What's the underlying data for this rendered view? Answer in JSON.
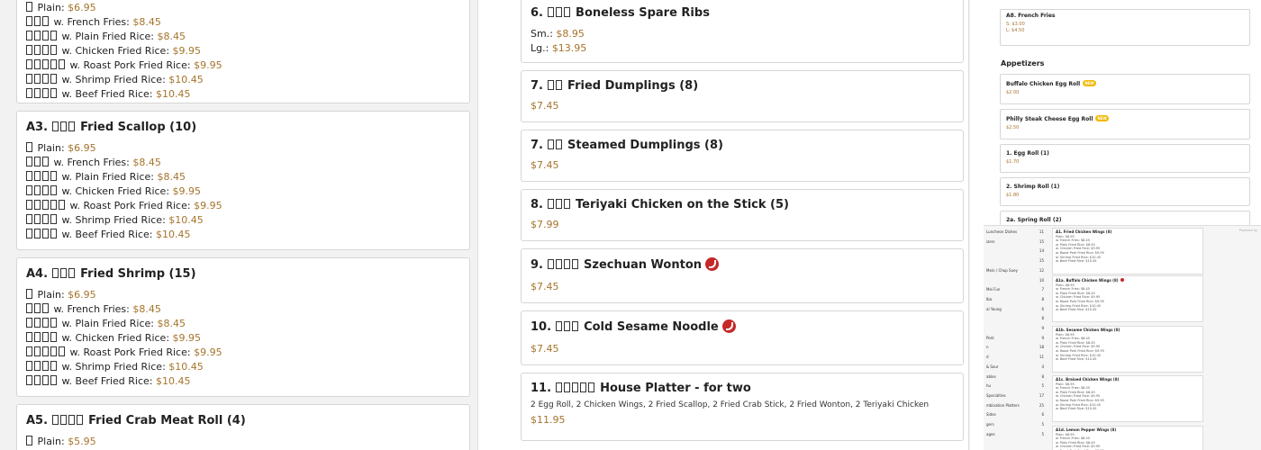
{
  "left": {
    "top_partial": {
      "lines": [
        {
          "sq": 1,
          "label": "Plain:",
          "price": "$6.95"
        },
        {
          "sq": 3,
          "label": "w. French Fries:",
          "price": "$8.45"
        },
        {
          "sq": 4,
          "label": "w. Plain Fried Rice:",
          "price": "$8.45"
        },
        {
          "sq": 4,
          "label": "w. Chicken Fried Rice:",
          "price": "$9.95"
        },
        {
          "sq": 5,
          "label": "w. Roast Pork Fried Rice:",
          "price": "$9.95"
        },
        {
          "sq": 4,
          "label": "w. Shrimp Fried Rice:",
          "price": "$10.45"
        },
        {
          "sq": 4,
          "label": "w. Beef Fried Rice:",
          "price": "$10.45"
        }
      ]
    },
    "a3": {
      "prefix": "A3.",
      "cn_count": 3,
      "title": "Fried Scallop (10)",
      "lines": [
        {
          "sq": 1,
          "label": "Plain:",
          "price": "$6.95"
        },
        {
          "sq": 3,
          "label": "w. French Fries:",
          "price": "$8.45"
        },
        {
          "sq": 4,
          "label": "w. Plain Fried Rice:",
          "price": "$8.45"
        },
        {
          "sq": 4,
          "label": "w. Chicken Fried Rice:",
          "price": "$9.95"
        },
        {
          "sq": 5,
          "label": "w. Roast Pork Fried Rice:",
          "price": "$9.95"
        },
        {
          "sq": 4,
          "label": "w. Shrimp Fried Rice:",
          "price": "$10.45"
        },
        {
          "sq": 4,
          "label": "w. Beef Fried Rice:",
          "price": "$10.45"
        }
      ]
    },
    "a4": {
      "prefix": "A4.",
      "cn_count": 3,
      "title": "Fried Shrimp (15)",
      "lines": [
        {
          "sq": 1,
          "label": "Plain:",
          "price": "$6.95"
        },
        {
          "sq": 3,
          "label": "w. French Fries:",
          "price": "$8.45"
        },
        {
          "sq": 4,
          "label": "w. Plain Fried Rice:",
          "price": "$8.45"
        },
        {
          "sq": 4,
          "label": "w. Chicken Fried Rice:",
          "price": "$9.95"
        },
        {
          "sq": 5,
          "label": "w. Roast Pork Fried Rice:",
          "price": "$9.95"
        },
        {
          "sq": 4,
          "label": "w. Shrimp Fried Rice:",
          "price": "$10.45"
        },
        {
          "sq": 4,
          "label": "w. Beef Fried Rice:",
          "price": "$10.45"
        }
      ]
    },
    "a5": {
      "prefix": "A5.",
      "cn_count": 4,
      "title": "Fried Crab Meat Roll (4)",
      "lines": [
        {
          "sq": 1,
          "label": "Plain:",
          "price": "$5.95"
        }
      ]
    }
  },
  "middle": {
    "items": [
      {
        "num": "6.",
        "cn_count": 3,
        "title": "Boneless Spare Ribs",
        "spicy": false,
        "prices": [
          {
            "label": "Sm.:",
            "price": "$8.95"
          },
          {
            "label": "Lg.:",
            "price": "$13.95"
          }
        ],
        "desc": ""
      },
      {
        "num": "7.",
        "cn_count": 2,
        "title": "Fried Dumplings (8)",
        "spicy": false,
        "prices": [
          {
            "label": "",
            "price": "$7.45"
          }
        ],
        "desc": ""
      },
      {
        "num": "7.",
        "cn_count": 2,
        "title": "Steamed Dumplings (8)",
        "spicy": false,
        "prices": [
          {
            "label": "",
            "price": "$7.45"
          }
        ],
        "desc": ""
      },
      {
        "num": "8.",
        "cn_count": 3,
        "title": "Teriyaki Chicken on the Stick (5)",
        "spicy": false,
        "prices": [
          {
            "label": "",
            "price": "$7.99"
          }
        ],
        "desc": ""
      },
      {
        "num": "9.",
        "cn_count": 4,
        "title": "Szechuan Wonton",
        "spicy": true,
        "prices": [
          {
            "label": "",
            "price": "$7.45"
          }
        ],
        "desc": ""
      },
      {
        "num": "10.",
        "cn_count": 3,
        "title": "Cold Sesame Noodle",
        "spicy": true,
        "prices": [
          {
            "label": "",
            "price": "$7.45"
          }
        ],
        "desc": ""
      },
      {
        "num": "11.",
        "cn_count": 5,
        "title": "House Platter - for two",
        "spicy": false,
        "prices": [
          {
            "label": "",
            "price": "$11.95"
          }
        ],
        "desc": "2 Egg Roll, 2 Chicken Wings, 2 Fried Scallop, 2 Fried Crab Stick, 2 Fried Wonton, 2 Teriyaki Chicken"
      }
    ]
  },
  "right": {
    "a8": {
      "title": "A8. French Fries",
      "lines": [
        "S: $3.00",
        "L: $4.50"
      ]
    },
    "section_heading": "Appetizers",
    "items": [
      {
        "title": "Buffalo Chicken Egg Roll",
        "new": true,
        "price": "$2.00"
      },
      {
        "title": "Philly Steak Cheese Egg Roll",
        "new": true,
        "price": "$2.50"
      },
      {
        "title": "1. Egg Roll (1)",
        "new": false,
        "price": "$1.70"
      },
      {
        "title": "2. Shrimp Roll (1)",
        "new": false,
        "price": "$1.80"
      },
      {
        "title": "2a. Spring Roll (2)",
        "new": false,
        "price": ""
      }
    ],
    "new_label": "NEW",
    "powered": "Powered by",
    "categories": [
      {
        "name": "Luncheon Dishes",
        "count": "11"
      },
      {
        "name": "izers",
        "count": "15"
      },
      {
        "name": "",
        "count": "14"
      },
      {
        "name": "",
        "count": "15"
      },
      {
        "name": "Mein / Chop Suey",
        "count": "12"
      },
      {
        "name": "",
        "count": "10"
      },
      {
        "name": "Mei Fun",
        "count": "7"
      },
      {
        "name": "Ibo",
        "count": "8"
      },
      {
        "name": "ai Young",
        "count": "6"
      },
      {
        "name": "",
        "count": "8"
      },
      {
        "name": "",
        "count": "9"
      },
      {
        "name": "Pork",
        "count": "9"
      },
      {
        "name": "n",
        "count": "18"
      },
      {
        "name": "d",
        "count": "11"
      },
      {
        "name": "& Sour",
        "count": "4"
      },
      {
        "name": "ables",
        "count": "8"
      },
      {
        "name": "hu",
        "count": "5"
      },
      {
        "name": "Specialties",
        "count": "17"
      },
      {
        "name": "mbination Platters",
        "count": "25"
      },
      {
        "name": "Sides",
        "count": "6"
      },
      {
        "name": "gers",
        "count": "5"
      },
      {
        "name": "ages",
        "count": "5"
      }
    ],
    "mini_cards": [
      {
        "title": "A1. Fried Chicken Wings (8)",
        "spicy": false
      },
      {
        "title": "A1a. Buffalo Chicken Wings (8)",
        "spicy": true
      },
      {
        "title": "A1b. Sesame Chicken Wings (8)",
        "spicy": false
      },
      {
        "title": "A1c. Braised Chicken Wings (8)",
        "spicy": false
      },
      {
        "title": "A1d. Lemon Pepper Wings (8)",
        "spicy": false
      }
    ],
    "mini_lines": [
      "Plain: $6.95",
      "w. French Fries: $8.45",
      "w. Plain Fried Rice: $8.45",
      "w. Chicken Fried Rice: $9.95",
      "w. Roast Pork Fried Rice: $9.95",
      "w. Shrimp Fried Rice: $10.45",
      "w. Beef Fried Rice: $10.45"
    ]
  }
}
